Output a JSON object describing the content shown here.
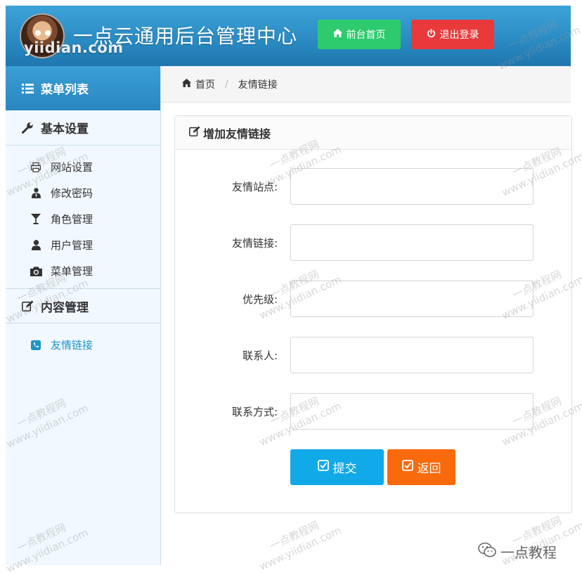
{
  "header": {
    "logo_text": "yiidian.com",
    "title": "一点云通用后台管理中心",
    "home_button": "前台首页",
    "logout_button": "退出登录"
  },
  "sidebar": {
    "menu_title": "菜单列表",
    "groups": [
      {
        "label": "基本设置",
        "items": [
          {
            "label": "网站设置",
            "icon": "print-icon"
          },
          {
            "label": "修改密码",
            "icon": "user-tie-icon"
          },
          {
            "label": "角色管理",
            "icon": "glass-icon"
          },
          {
            "label": "用户管理",
            "icon": "user-icon"
          },
          {
            "label": "菜单管理",
            "icon": "camera-icon"
          }
        ]
      },
      {
        "label": "内容管理",
        "items": [
          {
            "label": "友情链接",
            "icon": "phone-square-icon",
            "active": true
          }
        ]
      }
    ]
  },
  "breadcrumb": {
    "home": "首页",
    "current": "友情链接"
  },
  "panel": {
    "title": "增加友情链接",
    "fields": [
      {
        "label": "友情站点:",
        "value": "",
        "placeholder": ""
      },
      {
        "label": "友情链接:",
        "value": "",
        "placeholder": ""
      },
      {
        "label": "优先级:",
        "value": "",
        "placeholder": ""
      },
      {
        "label": "联系人:",
        "value": "",
        "placeholder": ""
      },
      {
        "label": "联系方式:",
        "value": "",
        "placeholder": ""
      }
    ],
    "submit_button": "提交",
    "back_button": "返回"
  },
  "watermark": {
    "line1": "一点教程网",
    "line2": "www.yiidian.com",
    "bottom_brand": "一点教程"
  },
  "colors": {
    "header_blue": "#2b8cc4",
    "home_green": "#2dcb6d",
    "logout_red": "#e83a3a",
    "submit_blue": "#12a9e8",
    "back_orange": "#f86a0c",
    "active_link": "#1e93c8"
  }
}
